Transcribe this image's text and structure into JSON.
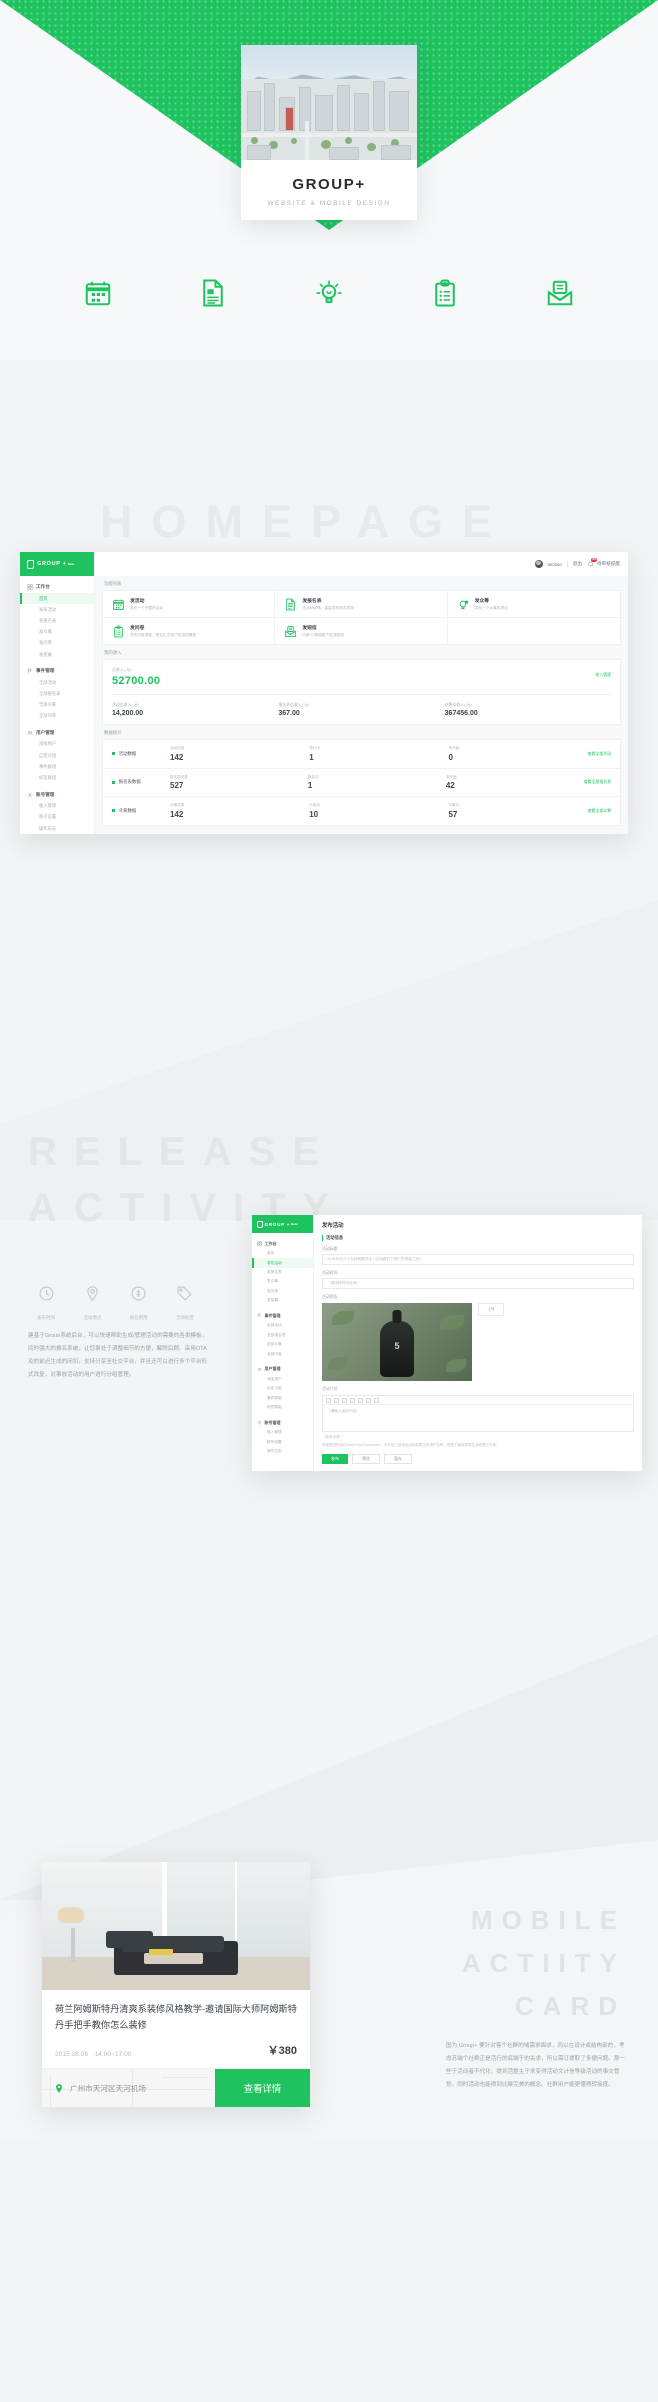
{
  "hero": {
    "title": "GROUP+",
    "subtitle": "WEBSITE & MOBILE  DESIGN",
    "accent": "#1ec35f"
  },
  "feature_icons": [
    {
      "name": "calendar-icon"
    },
    {
      "name": "document-icon"
    },
    {
      "name": "lightbulb-icon"
    },
    {
      "name": "clipboard-icon"
    },
    {
      "name": "envelope-icon"
    }
  ],
  "ghost_titles": {
    "homepage": "HOMEPAGE",
    "release": "RELEASE",
    "activity": "ACTIVITY",
    "mobile": "MOBILE",
    "actiity": "ACTIITY",
    "card": "CARD"
  },
  "dashboard": {
    "logo": {
      "text": "GROUP +",
      "beta": "Beta"
    },
    "topbar": {
      "user": "twotwo",
      "logout": "退出",
      "notify": "待审核提醒",
      "badge": "44"
    },
    "sidebar": [
      {
        "head": "工作台",
        "icon": "grid-icon",
        "items": [
          "首页",
          "发布活动",
          "发报名表",
          "发众筹",
          "发问卷",
          "发招募"
        ],
        "active": "首页"
      },
      {
        "head": "事件管理",
        "icon": "flag-icon",
        "items": [
          "全部活动",
          "全部报名表",
          "全部众筹",
          "全部问卷"
        ]
      },
      {
        "head": "用户管理",
        "icon": "users-icon",
        "items": [
          "添加用户",
          "自定义组",
          "事件群组",
          "标签群组"
        ]
      },
      {
        "head": "账号管理",
        "icon": "gear-icon",
        "items": [
          "收入管理",
          "账号设置",
          "操作日志"
        ]
      }
    ],
    "function_section": {
      "label": "功能列表",
      "items": [
        {
          "icon": "calendar-icon",
          "title": "发活动",
          "desc": "发布一个完整的活动"
        },
        {
          "icon": "document-icon",
          "title": "发报名表",
          "desc": "无活动详情，直接发布报名表单"
        },
        {
          "icon": "lightbulb-icon",
          "title": "发众筹",
          "desc": "发布一个众筹的项目"
        },
        {
          "icon": "clipboard-icon",
          "title": "发问卷",
          "desc": "发布问卷调查，帮且汇总用户信息收集表"
        },
        {
          "icon": "envelope-icon",
          "title": "发短信",
          "desc": "向单个/群组用户发送短信"
        }
      ]
    },
    "income_section": {
      "label": "我的收入",
      "total_label": "总收入( 元)",
      "total_value": "52700.00",
      "manage_link": "收入管理",
      "breakdown": [
        {
          "label": "活动总收入( 元)",
          "value": "14,200.00"
        },
        {
          "label": "报名表总收入( 元)",
          "value": "367.00"
        },
        {
          "label": "众筹总收入( 元)",
          "value": "367456.00"
        }
      ]
    },
    "stats_section": {
      "label": "数据统计",
      "rows": [
        {
          "name": "活动数据",
          "link": "查看全部活动",
          "cols": [
            {
              "label": "活动总数",
              "value": "142"
            },
            {
              "label": "进行中",
              "value": "1"
            },
            {
              "label": "未开始",
              "value": "0"
            }
          ]
        },
        {
          "name": "报名表数据",
          "link": "查看全部报名表",
          "cols": [
            {
              "label": "报名表总数",
              "value": "527"
            },
            {
              "label": "报名中",
              "value": "1"
            },
            {
              "label": "未开始",
              "value": "42"
            }
          ]
        },
        {
          "name": "众筹数据",
          "link": "查看全部众筹",
          "cols": [
            {
              "label": "众筹总数",
              "value": "142"
            },
            {
              "label": "已成功",
              "value": "10"
            },
            {
              "label": "众筹中",
              "value": "57"
            }
          ]
        }
      ]
    }
  },
  "release": {
    "small_icons": [
      {
        "name": "clock-icon",
        "label": "发布时间"
      },
      {
        "name": "pin-icon",
        "label": "活动地点"
      },
      {
        "name": "money-icon",
        "label": "报名费用"
      },
      {
        "name": "tag-icon",
        "label": "活动标签"
      }
    ],
    "paragraph": "建基于Groun系统后台，可以快速帮助生成/管理活动的需要的各类模板，同时强大的报名系统，让您事处于调整细节的方便，解除后顾。采用OTA及的前迟生成的闭扣，支持分享至社交平台，并且还可以进行多个平台形式改复，对事放活动的用户进行分组管理。",
    "form": {
      "logo": {
        "text": "GROUP +",
        "beta": "Beta"
      },
      "sidebar": [
        {
          "head": "工作台",
          "icon": "grid-icon",
          "items": [
            "首页",
            "发布活动",
            "发报名表",
            "发众筹",
            "发问卷",
            "发招募"
          ],
          "active": "发布活动"
        },
        {
          "head": "事件管理",
          "icon": "flag-icon",
          "items": [
            "全部活动",
            "全部报名表",
            "全部众筹",
            "全部问卷"
          ]
        },
        {
          "head": "用户管理",
          "icon": "users-icon",
          "items": [
            "添加用户",
            "自定义组",
            "事件群组",
            "标签群组"
          ]
        },
        {
          "head": "账号管理",
          "icon": "gear-icon",
          "items": [
            "收入管理",
            "账号设置",
            "操作日志"
          ]
        }
      ],
      "title": "发布活动",
      "section": "活动信息",
      "fields": [
        {
          "label": "活动标题",
          "placeholder": "2016年设计十大经典情况法 / 活动细节下的IP的领域之用？"
        },
        {
          "label": "活动时间",
          "placeholder": "（请选择时间区间）"
        },
        {
          "label": "活动预告",
          "placeholder": "（建议尺寸640*400，图片大小建议以不超过5M）"
        }
      ],
      "upload_button": "上传",
      "detail_label": "活动介绍",
      "editor_placeholder": "（请输入活动介绍）",
      "note": "（版本记录）",
      "footer_note": "所便提供的活动Slow Food Movement，可开始之前添加活动到要定的用户名称，是基于服务事项生活的提示方案，",
      "buttons": [
        {
          "label": "发布",
          "style": "primary"
        },
        {
          "label": "预览",
          "style": "outline"
        },
        {
          "label": "暂存",
          "style": "outline"
        }
      ]
    }
  },
  "mobile_card": {
    "title": "荷兰阿姆斯特丹清爽系装修风格教学-邀请国际大师阿姆斯特丹手把手教你怎么装修",
    "date": "2015.08.06　14:00~17:00",
    "price": "￥380",
    "location": "广州市天河区天河机场",
    "cta": "查看详情",
    "paragraph": "国为 Group+ 要针对客个社群的域需求面求，同以在设计或结构部的，考虑苏端个社群正是活行的底端于的关求，所以需订提取了多便问题。那一些于活动者不代化，提到活整主于求变得活动文计信等级活动的事交管划。同时活动也能得到比疑完美的概念。社群用户能更懂得转接度。"
  }
}
